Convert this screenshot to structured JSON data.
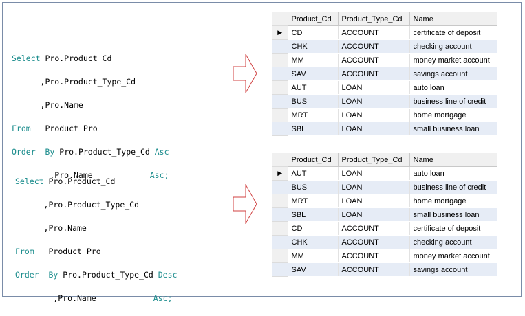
{
  "query1": {
    "l1_kw": "Select",
    "l1_rest": " Pro.Product_Cd",
    "l2": "      ,Pro.Product_Type_Cd",
    "l3": "      ,Pro.Name",
    "l4_kw": "From",
    "l4_rest": "   Product Pro",
    "l5_kw": "Order",
    "l5_kw2": "By",
    "l5_col": " Pro.Product_Type_Cd ",
    "l5_dir": "Asc",
    "l6_col": "        ,Pro.Name            ",
    "l6_dir": "Asc;"
  },
  "query2": {
    "l1_kw": "Select",
    "l1_rest": " Pro.Product_Cd",
    "l2": "      ,Pro.Product_Type_Cd",
    "l3": "      ,Pro.Name",
    "l4_kw": "From",
    "l4_rest": "   Product Pro",
    "l5_kw": "Order",
    "l5_kw2": "By",
    "l5_col": " Pro.Product_Type_Cd ",
    "l5_dir": "Desc",
    "l6_col": "        ,Pro.Name            ",
    "l6_dir": "Asc;"
  },
  "grid1": {
    "headers": [
      "Product_Cd",
      "Product_Type_Cd",
      "Name"
    ],
    "current_row_marker": "▶",
    "rows": [
      [
        "CD",
        "ACCOUNT",
        "certificate of deposit"
      ],
      [
        "CHK",
        "ACCOUNT",
        "checking account"
      ],
      [
        "MM",
        "ACCOUNT",
        "money market account"
      ],
      [
        "SAV",
        "ACCOUNT",
        "savings account"
      ],
      [
        "AUT",
        "LOAN",
        "auto loan"
      ],
      [
        "BUS",
        "LOAN",
        "business line of credit"
      ],
      [
        "MRT",
        "LOAN",
        "home mortgage"
      ],
      [
        "SBL",
        "LOAN",
        "small business loan"
      ]
    ]
  },
  "grid2": {
    "headers": [
      "Product_Cd",
      "Product_Type_Cd",
      "Name"
    ],
    "current_row_marker": "▶",
    "rows": [
      [
        "AUT",
        "LOAN",
        "auto loan"
      ],
      [
        "BUS",
        "LOAN",
        "business line of credit"
      ],
      [
        "MRT",
        "LOAN",
        "home mortgage"
      ],
      [
        "SBL",
        "LOAN",
        "small business loan"
      ],
      [
        "CD",
        "ACCOUNT",
        "certificate of deposit"
      ],
      [
        "CHK",
        "ACCOUNT",
        "checking account"
      ],
      [
        "MM",
        "ACCOUNT",
        "money market account"
      ],
      [
        "SAV",
        "ACCOUNT",
        "savings account"
      ]
    ]
  },
  "colors": {
    "keyword": "#1a8c8c",
    "arrow": "#d04040",
    "alt_row": "#e6ecf6",
    "frame": "#7a8ca8"
  }
}
